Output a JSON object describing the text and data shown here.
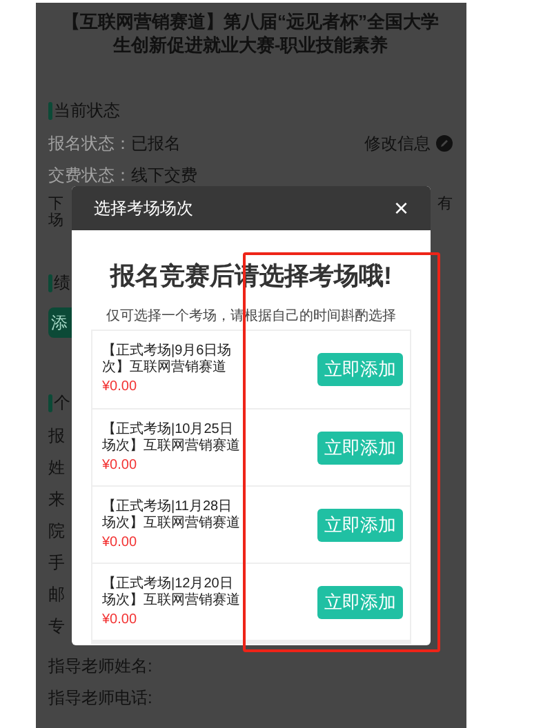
{
  "page": {
    "title": "【互联网营销赛道】第八届“远见者杯”全国大学生创新促进就业大赛-职业技能素养",
    "status_section": {
      "heading": "当前状态",
      "rows": [
        {
          "label": "报名状态：",
          "value": "已报名"
        },
        {
          "label": "交费状态：",
          "value": "线下交费"
        }
      ],
      "edit_link": "修改信息",
      "note_fragments": [
        "下",
        "有",
        "场"
      ]
    },
    "section_2": {
      "heading": "绩",
      "button": "添"
    },
    "section_3": {
      "heading": "个",
      "fields": [
        "报",
        "姓",
        "来",
        "院",
        "手",
        "邮",
        "专",
        "指导老师姓名:",
        "指导老师电话:"
      ]
    }
  },
  "modal": {
    "title": "选择考场场次",
    "close": "×",
    "heading": "报名竞赛后请选择考场哦!",
    "subtitle": "仅可选择一个考场，请根据自己的时间斟酌选择",
    "sessions": [
      {
        "name": "【正式考场|9月6日场次】互联网营销赛道",
        "price": "¥0.00",
        "button": "立即添加"
      },
      {
        "name": "【正式考场|10月25日场次】互联网营销赛道",
        "price": "¥0.00",
        "button": "立即添加"
      },
      {
        "name": "【正式考场|11月28日场次】互联网营销赛道",
        "price": "¥0.00",
        "button": "立即添加"
      },
      {
        "name": "【正式考场|12月20日场次】互联网营销赛道",
        "price": "¥0.00",
        "button": "立即添加"
      }
    ]
  },
  "annotation": {
    "kind": "highlight-box"
  }
}
